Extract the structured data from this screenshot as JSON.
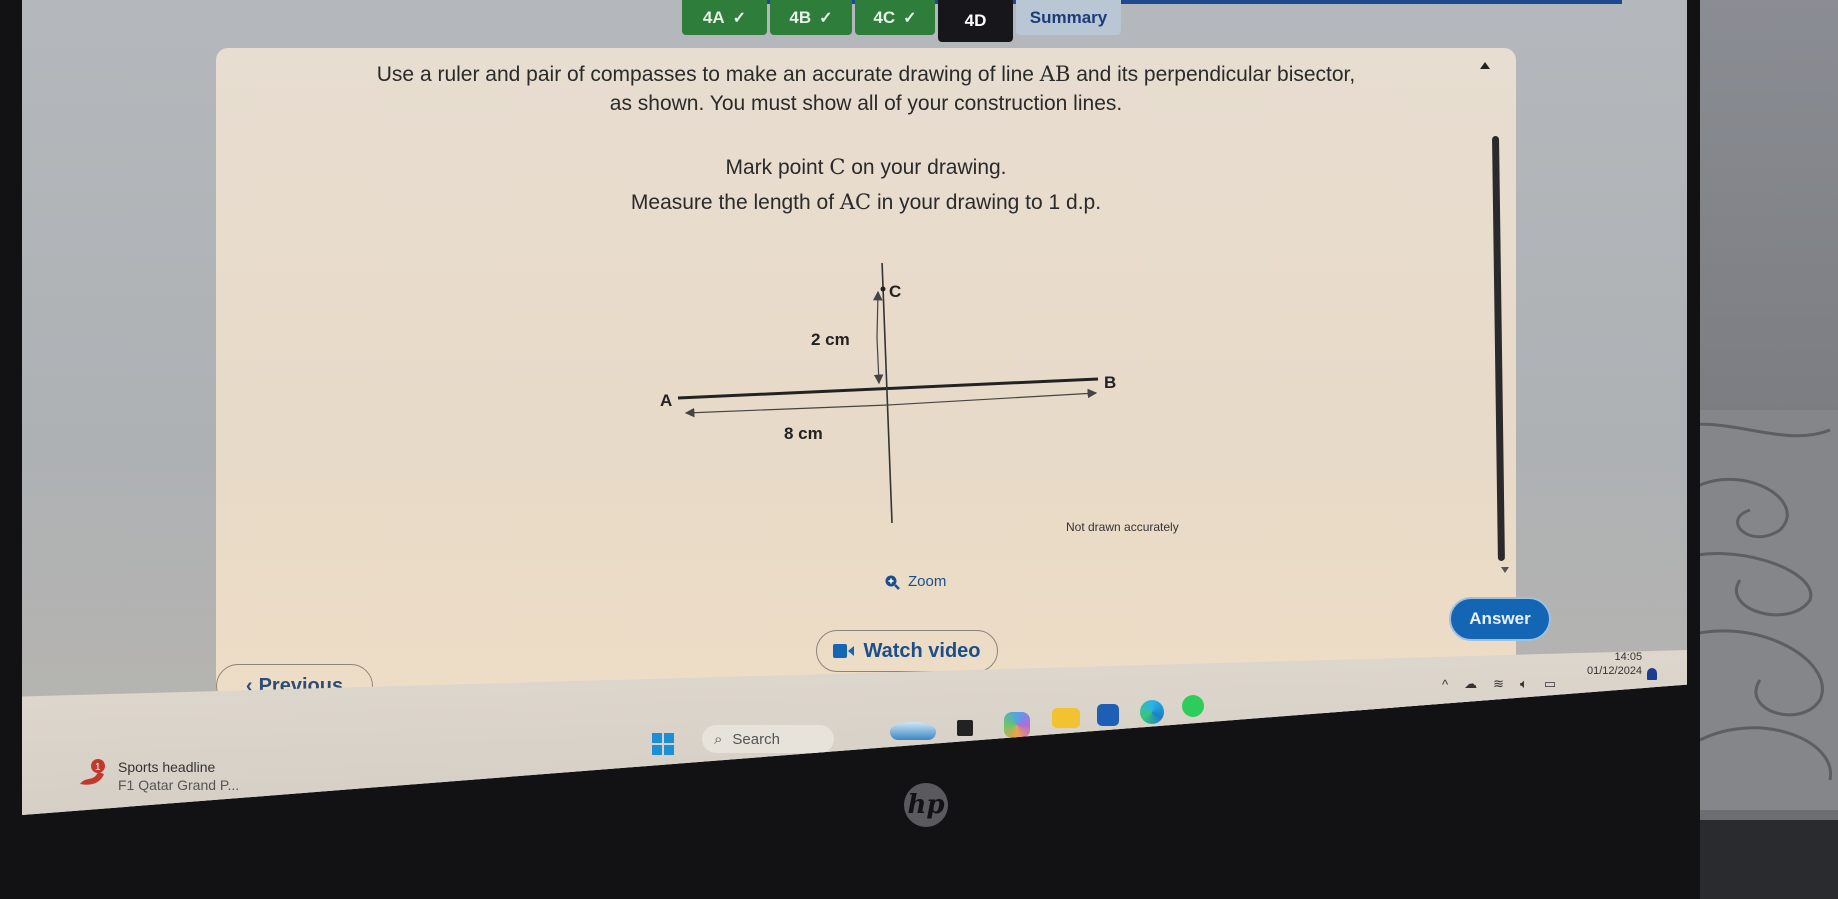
{
  "tabs": [
    {
      "label": "4A",
      "state": "done",
      "icon": "check-icon"
    },
    {
      "label": "4B",
      "state": "done",
      "icon": "check-icon"
    },
    {
      "label": "4C",
      "state": "done",
      "icon": "check-icon"
    },
    {
      "label": "4D",
      "state": "active"
    },
    {
      "label": "Summary",
      "state": "summary"
    }
  ],
  "question": {
    "line1_a": "Use a ruler and pair of compasses to make an accurate drawing of line ",
    "line1_m": "AB",
    "line1_b": " and its perpendicular bisector,",
    "line2": "as shown. You must show all of your construction lines.",
    "line3_a": "Mark point ",
    "line3_m": "C",
    "line3_b": " on your drawing.",
    "line4_a": "Measure the length of ",
    "line4_m": "AC",
    "line4_b": " in your drawing to 1 d.p."
  },
  "diagram": {
    "label_a": "A",
    "label_b": "B",
    "label_c": "C",
    "ab_length": "8 cm",
    "c_height": "2 cm",
    "note": "Not drawn accurately"
  },
  "actions": {
    "zoom_label": "Zoom",
    "watch_video_label": "Watch video",
    "answer_label": "Answer",
    "previous_label": "Previous"
  },
  "taskbar": {
    "news_title": "Sports headline",
    "news_sub": "F1 Qatar Grand P...",
    "news_badge": "1",
    "search_placeholder": "Search",
    "time": "14:05",
    "date": "01/12/2024"
  },
  "colors": {
    "tab_done": "#2e7d3a",
    "tab_active": "#17171b",
    "accent_blue": "#1565b5"
  }
}
